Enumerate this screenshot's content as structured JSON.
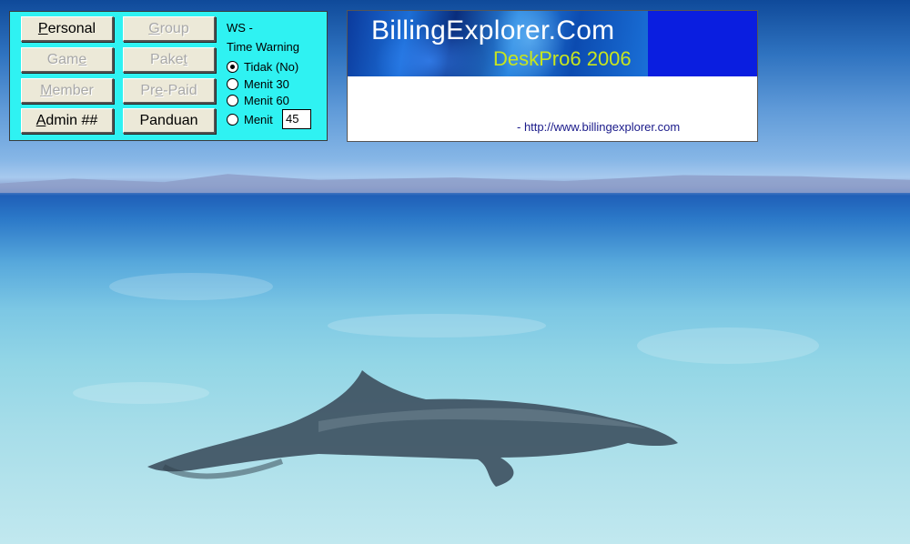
{
  "panel": {
    "buttons": [
      {
        "pre": "",
        "u": "P",
        "post": "ersonal",
        "enabled": true
      },
      {
        "pre": "",
        "u": "G",
        "post": "roup",
        "enabled": false
      },
      {
        "pre": "Gam",
        "u": "e",
        "post": "",
        "enabled": false
      },
      {
        "pre": "Pake",
        "u": "t",
        "post": "",
        "enabled": false
      },
      {
        "pre": "",
        "u": "M",
        "post": "ember",
        "enabled": false
      },
      {
        "pre": "Pr",
        "u": "e",
        "post": "-Paid",
        "enabled": false
      },
      {
        "pre": "",
        "u": "A",
        "post": "dmin ##",
        "enabled": true
      },
      {
        "pre": "",
        "u": "",
        "post": "Panduan",
        "enabled": true
      }
    ],
    "ws_label": "WS -",
    "time_warning_label": "Time Warning",
    "radios": [
      {
        "label": "Tidak (No)",
        "checked": true
      },
      {
        "label": "Menit  30",
        "checked": false
      },
      {
        "label": "Menit  60",
        "checked": false
      },
      {
        "label": "Menit",
        "checked": false
      }
    ],
    "menit_value": "45"
  },
  "banner": {
    "title": "BillingExplorer.Com",
    "subtitle": "DeskPro6 2006",
    "url": "- http://www.billingexplorer.com"
  },
  "colors": {
    "panel_bg": "#2ff2f2",
    "banner_blue": "#0a1ee0",
    "subtitle_green": "#c8e61e"
  }
}
